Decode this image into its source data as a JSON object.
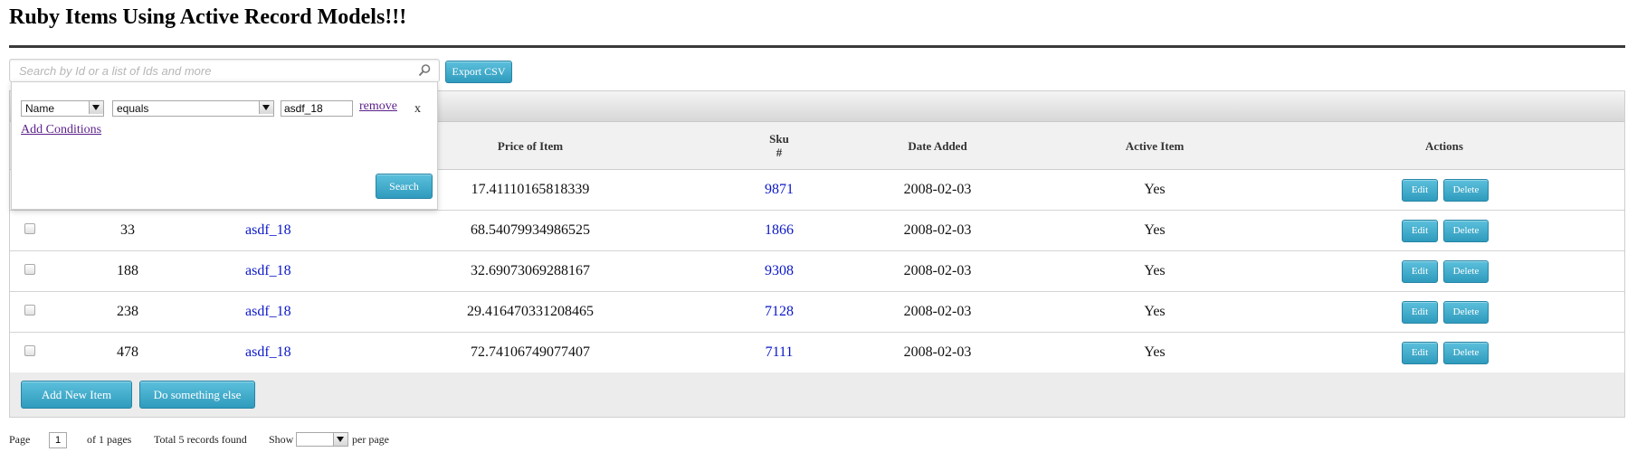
{
  "page": {
    "title": "Ruby Items Using Active Record Models!!!"
  },
  "search": {
    "placeholder": "Search by Id or a list of Ids and more",
    "value": ""
  },
  "toolbar": {
    "export_label": "Export CSV"
  },
  "filter": {
    "field": "Name",
    "operator": "equals",
    "value": "asdf_18",
    "remove_label": "remove",
    "close_label": "x",
    "add_conditions_label": "Add Conditions",
    "search_label": "Search"
  },
  "table": {
    "headers": {
      "price": "Price of Item",
      "sku_line1": "Sku",
      "sku_line2": "#",
      "date": "Date Added",
      "active": "Active Item",
      "actions": "Actions"
    },
    "rows": [
      {
        "id": "",
        "name": "",
        "price": "17.41110165818339",
        "sku": "9871",
        "date": "2008-02-03",
        "active": "Yes",
        "checkbox_visible": false
      },
      {
        "id": "33",
        "name": "asdf_18",
        "price": "68.54079934986525",
        "sku": "1866",
        "date": "2008-02-03",
        "active": "Yes",
        "checkbox_visible": true
      },
      {
        "id": "188",
        "name": "asdf_18",
        "price": "32.69073069288167",
        "sku": "9308",
        "date": "2008-02-03",
        "active": "Yes",
        "checkbox_visible": true
      },
      {
        "id": "238",
        "name": "asdf_18",
        "price": "29.416470331208465",
        "sku": "7128",
        "date": "2008-02-03",
        "active": "Yes",
        "checkbox_visible": true
      },
      {
        "id": "478",
        "name": "asdf_18",
        "price": "72.74106749077407",
        "sku": "7111",
        "date": "2008-02-03",
        "active": "Yes",
        "checkbox_visible": true
      }
    ],
    "row_actions": {
      "edit_label": "Edit",
      "delete_label": "Delete"
    },
    "footer": {
      "add_label": "Add New Item",
      "other_label": "Do something else"
    }
  },
  "pager": {
    "page_label": "Page",
    "page_value": "1",
    "of_pages": "of 1 pages",
    "records": "Total 5 records found",
    "show_label": "Show",
    "per_page": "per page"
  },
  "colors": {
    "button": "#3aa7c8",
    "link": "#0b18c8",
    "visited_link": "#5b1f8a"
  }
}
